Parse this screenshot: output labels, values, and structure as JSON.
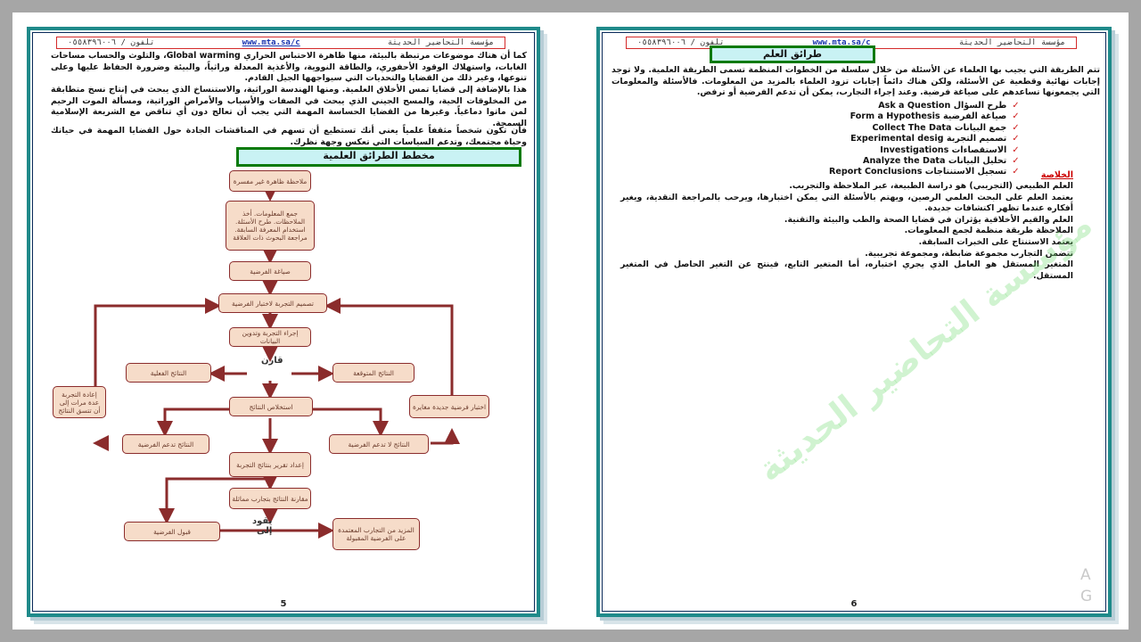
{
  "header": {
    "org": "مؤسسة التحاضير الحديثة",
    "url": "www.mta.sa/c",
    "phone": "تلفون / ٠٥٥٨٣٩٦٠٠٦"
  },
  "left_page": {
    "paragraph1": "كما أن هناك موضوعات مرتبطة بالبيئة، منها ظاهرة الاحتباس الحراري Global warming، والتلوث والحساب مساحات الغابات، واستهلاك الوقود الأحفوري، والطاقة النووية، والأغذية المعدلة وراثياً، والبيئة وضرورة الحفاظ عليها وعلى تنوعها، وغير ذلك من القضايا والتحديات التي سيواجهها الجيل القادم.",
    "paragraph2": "هذا بالإضافة إلى قضايا تمس الأخلاق العلمية. ومنها الهندسة الوراثية، والاستنساخ الذي يبحث في إنتاج نسخ متطابقة من المخلوقات الحية، والمسح الجيني الذي يبحث في الصفات والأسباب والأمراض الوراثية، ومسألة الموت الرحيم لمن ماتوا دماغياً. وغيرها من القضايا الحساسة المهمة التي يجب أن تعالج دون أي تناقض مع الشريعة الإسلامية السمحة.",
    "paragraph3": "فأن تكون شخصاً مثقفاً علمياً يعني أنك تستطيع أن تسهم في المناقشات الجادة حول القضايا المهمة في حياتك وحياة مجتمعك، وتدعم السياسات التي تعكس وجهة نظرك.",
    "chart_title": "مخطط الطرائق العلمية",
    "page_number": "5",
    "flow": {
      "observation": "ملاحظة ظاهرة غير مفسرة",
      "collect_info": "جمع المعلومات. أخذ الملاحظات. طرح الأسئلة. استخدام المعرفة السابقة. مراجعة البحوث ذات العلاقة",
      "hypothesis": "صياغة الفرضية",
      "design": "تصميم التجربة لاختبار الفرضية",
      "experiment": "إجراء التجربة وتدوين البيانات",
      "compare": "قارن",
      "actual": "النتائج الفعلية",
      "expected": "النتائج المتوقعة",
      "repeat": "إعادة التجربة عدة مرات إلى أن تتسق النتائج",
      "conclude": "استخلاص النتائج",
      "new_hypothesis": "اختبار فرضية جديدة مغايرة",
      "support": "النتائج تدعم الفرضية",
      "not_support": "النتائج لا تدعم الفرضية",
      "report": "إعداد تقرير بنتائج التجربة",
      "compare_results": "مقارنة النتائج بتجارب مماثلة",
      "accept": "قبول الفرضية",
      "leads_to": "يقود إلى",
      "more": "المزيد من التجارب المعتمدة على الفرضية المقبولة"
    }
  },
  "right_page": {
    "title": "طرائق العلم",
    "intro": "تتم الطريقة التي يجيب بها العلماء عن الأسئلة من خلال سلسلة من الخطوات المنظمة تسمى الطريقة العلمية. ولا توجد إجابات نهائية وقطعية عن الأسئلة، ولكن هناك دائماً إجابات تزود العلماء بالمزيد من المعلومات. فالأسئلة والمعلومات التي يجمعونها تساعدهم على صياغة فرضية. وعند إجراء التجارب، يمكن أن تدعم الفرضية أو ترفض.",
    "steps": [
      "طرح السؤال  Ask a Question",
      "صياغة الفرضية  Form a Hypothesis",
      "جمع البيانات  Collect The Data",
      "تصميم التجربة Experimental desig",
      "الاستقصاءات Investigations",
      "تحليل البيانات Analyze the Data",
      "تسجيل الاستنتاجات  Report Conclusions"
    ],
    "summary_heading": "الخلاصة",
    "summary": [
      "العلم الطبيعي (التجريبي) هو دراسة الطبيعة، عبر الملاحظة والتجريب.",
      "يعتمد العلم على البحث العلمي الرصين، ويهتم بالأسئلة التي يمكن اختبارها، ويرحب بالمراجعة النقدية، ويغير أفكاره عندما تظهر اكتشافات جديدة.",
      "العلم والقيم الأخلاقية يؤثران في قضايا الصحة والطب والبيئة والتقنية.",
      "الملاحظة طريقة منظمة لجمع المعلومات.",
      "يعتمد الاستنتاج على الخبرات السابقة.",
      "تتضمن التجارب مجموعة ضابطة، ومجموعة تجريبية.",
      "المتغير المستقل هو العامل الذي يجري اختباره، أما المتغير التابع، فينتج عن التغير الحاصل في المتغير المستقل."
    ],
    "watermark": "مؤسسة التحاضير الحديثة",
    "page_number": "6"
  },
  "corner_mark": "A\nG"
}
